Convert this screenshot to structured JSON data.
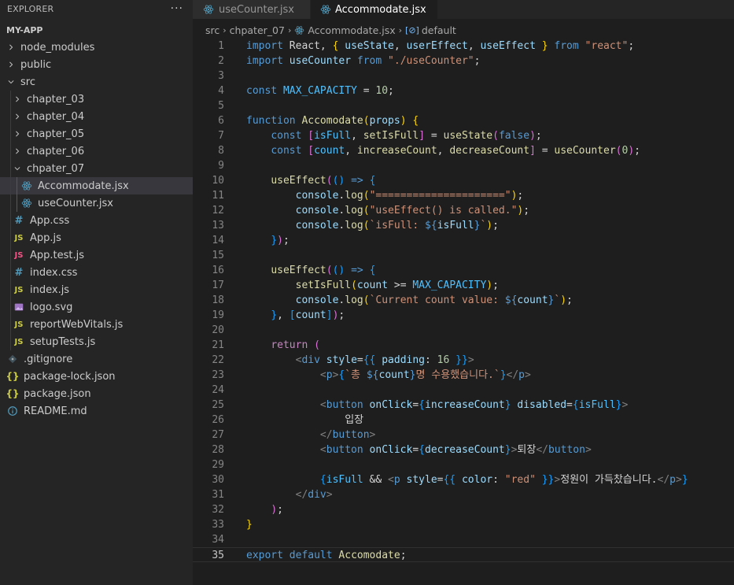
{
  "sidebar": {
    "title": "EXPLORER",
    "more": "···",
    "section": "MY-APP",
    "items": [
      {
        "label": "node_modules",
        "kind": "folder",
        "depth": 0,
        "open": false,
        "icon": "chevron-right-icon"
      },
      {
        "label": "public",
        "kind": "folder",
        "depth": 0,
        "open": false,
        "icon": "chevron-right-icon"
      },
      {
        "label": "src",
        "kind": "folder",
        "depth": 0,
        "open": true,
        "icon": "chevron-down-icon"
      },
      {
        "label": "chapter_03",
        "kind": "folder",
        "depth": 1,
        "open": false,
        "icon": "chevron-right-icon"
      },
      {
        "label": "chapter_04",
        "kind": "folder",
        "depth": 1,
        "open": false,
        "icon": "chevron-right-icon"
      },
      {
        "label": "chapter_05",
        "kind": "folder",
        "depth": 1,
        "open": false,
        "icon": "chevron-right-icon"
      },
      {
        "label": "chapter_06",
        "kind": "folder",
        "depth": 1,
        "open": false,
        "icon": "chevron-right-icon"
      },
      {
        "label": "chpater_07",
        "kind": "folder",
        "depth": 1,
        "open": true,
        "icon": "chevron-down-icon"
      },
      {
        "label": "Accommodate.jsx",
        "kind": "react",
        "depth": 2,
        "active": true,
        "icon": "react-icon"
      },
      {
        "label": "useCounter.jsx",
        "kind": "react",
        "depth": 2,
        "icon": "react-icon"
      },
      {
        "label": "App.css",
        "kind": "css",
        "depth": 1,
        "icon": "hash-icon",
        "glyph": "#"
      },
      {
        "label": "App.js",
        "kind": "js",
        "depth": 1,
        "icon": "js-icon",
        "glyph": "JS"
      },
      {
        "label": "App.test.js",
        "kind": "test",
        "depth": 1,
        "icon": "js-test-icon",
        "glyph": "JS"
      },
      {
        "label": "index.css",
        "kind": "css",
        "depth": 1,
        "icon": "hash-icon",
        "glyph": "#"
      },
      {
        "label": "index.js",
        "kind": "js",
        "depth": 1,
        "icon": "js-icon",
        "glyph": "JS"
      },
      {
        "label": "logo.svg",
        "kind": "svg",
        "depth": 1,
        "icon": "image-icon"
      },
      {
        "label": "reportWebVitals.js",
        "kind": "js",
        "depth": 1,
        "icon": "js-icon",
        "glyph": "JS"
      },
      {
        "label": "setupTests.js",
        "kind": "js",
        "depth": 1,
        "icon": "js-icon",
        "glyph": "JS"
      },
      {
        "label": ".gitignore",
        "kind": "git",
        "depth": 0,
        "icon": "git-icon"
      },
      {
        "label": "package-lock.json",
        "kind": "json",
        "depth": 0,
        "icon": "json-icon",
        "glyph": "{}"
      },
      {
        "label": "package.json",
        "kind": "json",
        "depth": 0,
        "icon": "json-icon",
        "glyph": "{}"
      },
      {
        "label": "README.md",
        "kind": "info",
        "depth": 0,
        "icon": "info-icon"
      }
    ]
  },
  "tabs": [
    {
      "label": "useCounter.jsx",
      "active": false,
      "icon": "react-icon"
    },
    {
      "label": "Accommodate.jsx",
      "active": true,
      "modified": true,
      "icon": "react-icon"
    }
  ],
  "breadcrumb": {
    "parts": [
      "src",
      "chpater_07",
      "Accommodate.jsx",
      "default"
    ],
    "symbol_glyph": "[⊘]"
  },
  "editor": {
    "current_line": 35,
    "lines": [
      [
        [
          "kw",
          "import"
        ],
        [
          "def",
          " React, "
        ],
        [
          "b1",
          "{"
        ],
        [
          "def",
          " "
        ],
        [
          "var",
          "useState"
        ],
        [
          "def",
          ", "
        ],
        [
          "var",
          "userEffect"
        ],
        [
          "def",
          ", "
        ],
        [
          "var",
          "useEffect"
        ],
        [
          "def",
          " "
        ],
        [
          "b1",
          "}"
        ],
        [
          "def",
          " "
        ],
        [
          "kw",
          "from"
        ],
        [
          "def",
          " "
        ],
        [
          "str",
          "\"react\""
        ],
        [
          "def",
          ";"
        ]
      ],
      [
        [
          "kw",
          "import"
        ],
        [
          "def",
          " "
        ],
        [
          "var",
          "useCounter"
        ],
        [
          "def",
          " "
        ],
        [
          "kw",
          "from"
        ],
        [
          "def",
          " "
        ],
        [
          "str",
          "\"./useCounter\""
        ],
        [
          "def",
          ";"
        ]
      ],
      [],
      [
        [
          "kw",
          "const"
        ],
        [
          "def",
          " "
        ],
        [
          "const",
          "MAX_CAPACITY"
        ],
        [
          "def",
          " = "
        ],
        [
          "num",
          "10"
        ],
        [
          "def",
          ";"
        ]
      ],
      [],
      [
        [
          "kw",
          "function"
        ],
        [
          "def",
          " "
        ],
        [
          "fn",
          "Accomodate"
        ],
        [
          "b1",
          "("
        ],
        [
          "var",
          "props"
        ],
        [
          "b1",
          ")"
        ],
        [
          "def",
          " "
        ],
        [
          "b1",
          "{"
        ]
      ],
      [
        [
          "def",
          "    "
        ],
        [
          "kw",
          "const"
        ],
        [
          "def",
          " "
        ],
        [
          "b2",
          "["
        ],
        [
          "const",
          "isFull"
        ],
        [
          "def",
          ", "
        ],
        [
          "fn",
          "setIsFull"
        ],
        [
          "b2",
          "]"
        ],
        [
          "def",
          " = "
        ],
        [
          "fn",
          "useState"
        ],
        [
          "b2",
          "("
        ],
        [
          "kw",
          "false"
        ],
        [
          "b2",
          ")"
        ],
        [
          "def",
          ";"
        ]
      ],
      [
        [
          "def",
          "    "
        ],
        [
          "kw",
          "const"
        ],
        [
          "def",
          " "
        ],
        [
          "b2",
          "["
        ],
        [
          "const",
          "count"
        ],
        [
          "def",
          ", "
        ],
        [
          "fn",
          "increaseCount"
        ],
        [
          "def",
          ", "
        ],
        [
          "fn",
          "decreaseCount"
        ],
        [
          "b2",
          "]"
        ],
        [
          "def",
          " = "
        ],
        [
          "fn",
          "useCounter"
        ],
        [
          "b2",
          "("
        ],
        [
          "num",
          "0"
        ],
        [
          "b2",
          ")"
        ],
        [
          "def",
          ";"
        ]
      ],
      [],
      [
        [
          "def",
          "    "
        ],
        [
          "fn",
          "useEffect"
        ],
        [
          "b2",
          "("
        ],
        [
          "b3",
          "()"
        ],
        [
          "def",
          " "
        ],
        [
          "kw",
          "=>"
        ],
        [
          "def",
          " "
        ],
        [
          "b3",
          "{"
        ]
      ],
      [
        [
          "def",
          "        "
        ],
        [
          "var",
          "console"
        ],
        [
          "def",
          "."
        ],
        [
          "fn",
          "log"
        ],
        [
          "b1",
          "("
        ],
        [
          "str",
          "\"=====================\""
        ],
        [
          "b1",
          ")"
        ],
        [
          "def",
          ";"
        ]
      ],
      [
        [
          "def",
          "        "
        ],
        [
          "var",
          "console"
        ],
        [
          "def",
          "."
        ],
        [
          "fn",
          "log"
        ],
        [
          "b1",
          "("
        ],
        [
          "str",
          "\"useEffect() is called.\""
        ],
        [
          "b1",
          ")"
        ],
        [
          "def",
          ";"
        ]
      ],
      [
        [
          "def",
          "        "
        ],
        [
          "var",
          "console"
        ],
        [
          "def",
          "."
        ],
        [
          "fn",
          "log"
        ],
        [
          "b1",
          "("
        ],
        [
          "str",
          "`isFull: "
        ],
        [
          "kw",
          "${"
        ],
        [
          "var",
          "isFull"
        ],
        [
          "kw",
          "}"
        ],
        [
          "str",
          "`"
        ],
        [
          "b1",
          ")"
        ],
        [
          "def",
          ";"
        ]
      ],
      [
        [
          "def",
          "    "
        ],
        [
          "b3",
          "}"
        ],
        [
          "b2",
          ")"
        ],
        [
          "def",
          ";"
        ]
      ],
      [],
      [
        [
          "def",
          "    "
        ],
        [
          "fn",
          "useEffect"
        ],
        [
          "b2",
          "("
        ],
        [
          "b3",
          "()"
        ],
        [
          "def",
          " "
        ],
        [
          "kw",
          "=>"
        ],
        [
          "def",
          " "
        ],
        [
          "b3",
          "{"
        ]
      ],
      [
        [
          "def",
          "        "
        ],
        [
          "fn",
          "setIsFull"
        ],
        [
          "b1",
          "("
        ],
        [
          "var",
          "count"
        ],
        [
          "def",
          " >= "
        ],
        [
          "const",
          "MAX_CAPACITY"
        ],
        [
          "b1",
          ")"
        ],
        [
          "def",
          ";"
        ]
      ],
      [
        [
          "def",
          "        "
        ],
        [
          "var",
          "console"
        ],
        [
          "def",
          "."
        ],
        [
          "fn",
          "log"
        ],
        [
          "b1",
          "("
        ],
        [
          "str",
          "`Current count value: "
        ],
        [
          "kw",
          "${"
        ],
        [
          "var",
          "count"
        ],
        [
          "kw",
          "}"
        ],
        [
          "str",
          "`"
        ],
        [
          "b1",
          ")"
        ],
        [
          "def",
          ";"
        ]
      ],
      [
        [
          "def",
          "    "
        ],
        [
          "b3",
          "}"
        ],
        [
          "def",
          ", "
        ],
        [
          "b3",
          "["
        ],
        [
          "var",
          "count"
        ],
        [
          "b3",
          "]"
        ],
        [
          "b2",
          ")"
        ],
        [
          "def",
          ";"
        ]
      ],
      [],
      [
        [
          "def",
          "    "
        ],
        [
          "ctl",
          "return"
        ],
        [
          "def",
          " "
        ],
        [
          "b2",
          "("
        ]
      ],
      [
        [
          "def",
          "        "
        ],
        [
          "tagbr",
          "<"
        ],
        [
          "tag",
          "div"
        ],
        [
          "def",
          " "
        ],
        [
          "attr",
          "style"
        ],
        [
          "def",
          "="
        ],
        [
          "b3",
          "{{"
        ],
        [
          "def",
          " "
        ],
        [
          "var",
          "padding"
        ],
        [
          "def",
          ": "
        ],
        [
          "num",
          "16"
        ],
        [
          "def",
          " "
        ],
        [
          "b3",
          "}}"
        ],
        [
          "tagbr",
          ">"
        ]
      ],
      [
        [
          "def",
          "            "
        ],
        [
          "tagbr",
          "<"
        ],
        [
          "tag",
          "p"
        ],
        [
          "tagbr",
          ">"
        ],
        [
          "b3",
          "{"
        ],
        [
          "str",
          "`총 "
        ],
        [
          "kw",
          "${"
        ],
        [
          "var",
          "count"
        ],
        [
          "kw",
          "}"
        ],
        [
          "str",
          "명 수용했습니다.`"
        ],
        [
          "b3",
          "}"
        ],
        [
          "tagbr",
          "</"
        ],
        [
          "tag",
          "p"
        ],
        [
          "tagbr",
          ">"
        ]
      ],
      [],
      [
        [
          "def",
          "            "
        ],
        [
          "tagbr",
          "<"
        ],
        [
          "tag",
          "button"
        ],
        [
          "def",
          " "
        ],
        [
          "attr",
          "onClick"
        ],
        [
          "def",
          "="
        ],
        [
          "b3",
          "{"
        ],
        [
          "var",
          "increaseCount"
        ],
        [
          "b3",
          "}"
        ],
        [
          "def",
          " "
        ],
        [
          "attr",
          "disabled"
        ],
        [
          "def",
          "="
        ],
        [
          "b3",
          "{"
        ],
        [
          "const",
          "isFull"
        ],
        [
          "b3",
          "}"
        ],
        [
          "tagbr",
          ">"
        ]
      ],
      [
        [
          "def",
          "                입장"
        ]
      ],
      [
        [
          "def",
          "            "
        ],
        [
          "tagbr",
          "</"
        ],
        [
          "tag",
          "button"
        ],
        [
          "tagbr",
          ">"
        ]
      ],
      [
        [
          "def",
          "            "
        ],
        [
          "tagbr",
          "<"
        ],
        [
          "tag",
          "button"
        ],
        [
          "def",
          " "
        ],
        [
          "attr",
          "onClick"
        ],
        [
          "def",
          "="
        ],
        [
          "b3",
          "{"
        ],
        [
          "var",
          "decreaseCount"
        ],
        [
          "b3",
          "}"
        ],
        [
          "tagbr",
          ">"
        ],
        [
          "def",
          "퇴장"
        ],
        [
          "tagbr",
          "</"
        ],
        [
          "tag",
          "button"
        ],
        [
          "tagbr",
          ">"
        ]
      ],
      [],
      [
        [
          "def",
          "            "
        ],
        [
          "b3",
          "{"
        ],
        [
          "const",
          "isFull"
        ],
        [
          "def",
          " && "
        ],
        [
          "tagbr",
          "<"
        ],
        [
          "tag",
          "p"
        ],
        [
          "def",
          " "
        ],
        [
          "attr",
          "style"
        ],
        [
          "def",
          "="
        ],
        [
          "b3",
          "{{"
        ],
        [
          "def",
          " "
        ],
        [
          "var",
          "color"
        ],
        [
          "def",
          ": "
        ],
        [
          "str",
          "\"red\""
        ],
        [
          "def",
          " "
        ],
        [
          "b3",
          "}}"
        ],
        [
          "tagbr",
          ">"
        ],
        [
          "def",
          "정원이 가득찼습니다."
        ],
        [
          "tagbr",
          "</"
        ],
        [
          "tag",
          "p"
        ],
        [
          "tagbr",
          ">"
        ],
        [
          "b3",
          "}"
        ]
      ],
      [
        [
          "def",
          "        "
        ],
        [
          "tagbr",
          "</"
        ],
        [
          "tag",
          "div"
        ],
        [
          "tagbr",
          ">"
        ]
      ],
      [
        [
          "def",
          "    "
        ],
        [
          "b2",
          ")"
        ],
        [
          "def",
          ";"
        ]
      ],
      [
        [
          "b1",
          "}"
        ]
      ],
      [],
      [
        [
          "kw",
          "export"
        ],
        [
          "def",
          " "
        ],
        [
          "kw",
          "default"
        ],
        [
          "def",
          " "
        ],
        [
          "fn",
          "Accomodate"
        ],
        [
          "def",
          ";"
        ]
      ]
    ]
  },
  "colors": {
    "background": "#1e1e1e",
    "sidebar": "#252526",
    "keyword": "#569cd6",
    "function": "#dcdcaa",
    "variable": "#9cdcfe",
    "string": "#ce9178",
    "number": "#b5cea8",
    "react": "#519aba",
    "js": "#cbcb41"
  }
}
